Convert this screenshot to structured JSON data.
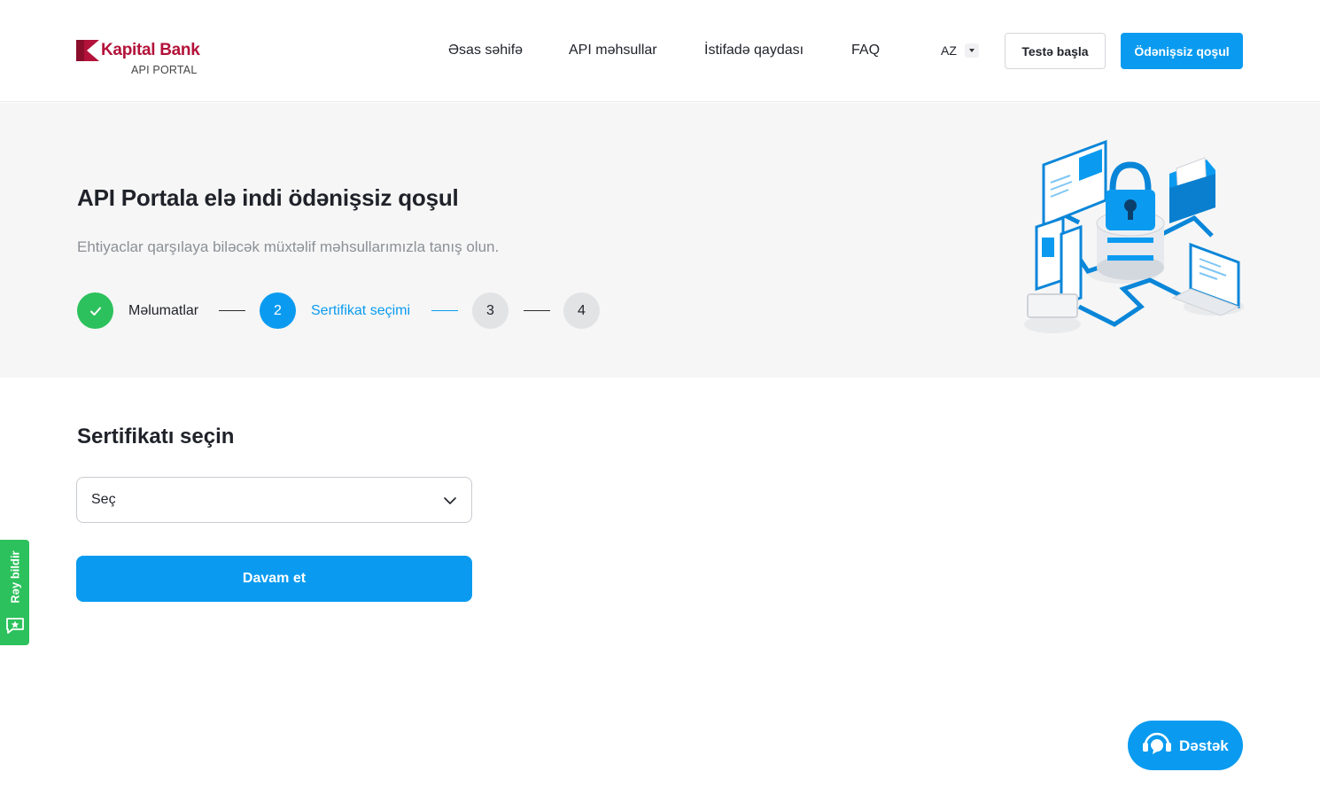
{
  "brand": {
    "name": "Kapital Bank",
    "subtitle": "API PORTAL",
    "color": "#b3123a"
  },
  "nav": {
    "items": [
      {
        "label": "Əsas səhifə"
      },
      {
        "label": "API məhsullar"
      },
      {
        "label": "İstifadə qaydası"
      },
      {
        "label": "FAQ"
      }
    ],
    "language": "AZ",
    "test_button": "Testə başla",
    "signup_button": "Ödənişsiz qoşul"
  },
  "hero": {
    "title": "API Portala elə indi ödənişsiz qoşul",
    "subtitle": "Ehtiyaclar qarşılaya biləcək müxtəlif məhsullarımızla tanış olun."
  },
  "steps": [
    {
      "number": "1",
      "label": "Məlumatlar",
      "status": "done"
    },
    {
      "number": "2",
      "label": "Sertifikat seçimi",
      "status": "active"
    },
    {
      "number": "3",
      "label": "",
      "status": "todo"
    },
    {
      "number": "4",
      "label": "",
      "status": "todo"
    }
  ],
  "form": {
    "title": "Sertifikatı seçin",
    "select_value": "Seç",
    "continue_button": "Davam et"
  },
  "feedback": {
    "label": "Rəy bildir"
  },
  "support": {
    "label": "Dəstək"
  },
  "colors": {
    "primary": "#0a9bf0",
    "success": "#2cc15c",
    "hero_bg": "#f6f6f6",
    "muted_text": "#8c9096"
  }
}
